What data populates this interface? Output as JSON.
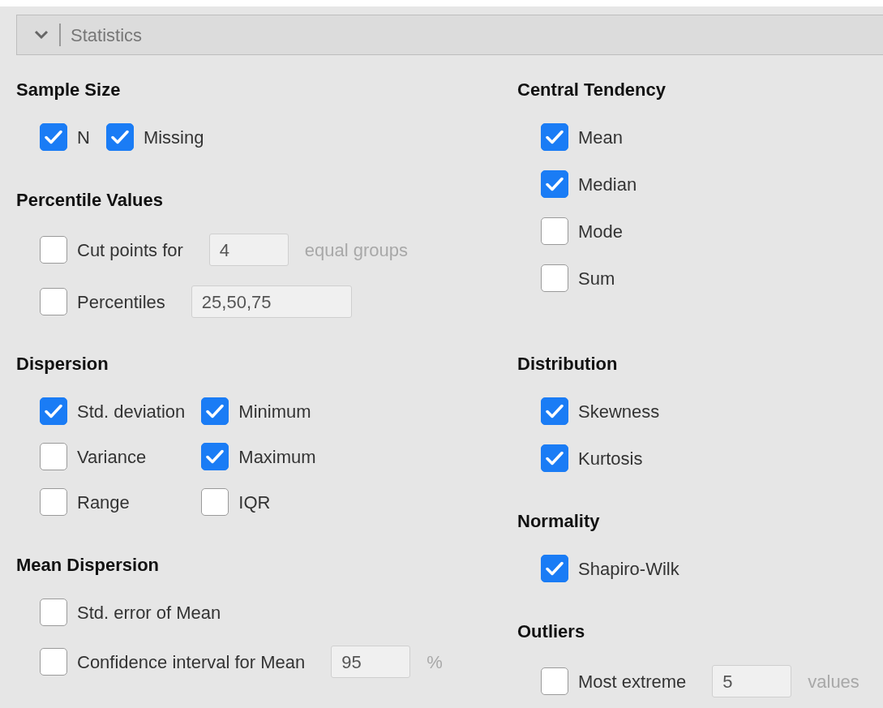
{
  "header": {
    "title": "Statistics",
    "expanded": true
  },
  "blocks": [
    {
      "left": [
        {
          "title": "Sample Size",
          "kind": "row",
          "items": [
            {
              "kind": "check",
              "label": "N",
              "checked": true
            },
            {
              "kind": "check",
              "label": "Missing",
              "checked": true
            }
          ]
        },
        {
          "title": "Percentile Values",
          "kind": "column",
          "items": [
            {
              "kind": "check-field",
              "label": "Cut points for",
              "checked": false,
              "value": "4",
              "suffix": "equal groups"
            },
            {
              "kind": "check-field",
              "label": "Percentiles",
              "checked": false,
              "value": "25,50,75"
            }
          ]
        }
      ],
      "right": [
        {
          "title": "Central Tendency",
          "kind": "column",
          "items": [
            {
              "kind": "check",
              "label": "Mean",
              "checked": true
            },
            {
              "kind": "check",
              "label": "Median",
              "checked": true
            },
            {
              "kind": "check",
              "label": "Mode",
              "checked": false
            },
            {
              "kind": "check",
              "label": "Sum",
              "checked": false
            }
          ]
        }
      ]
    },
    {
      "left": [
        {
          "title": "Dispersion",
          "kind": "grid",
          "items": [
            {
              "kind": "check",
              "label": "Std. deviation",
              "checked": true
            },
            {
              "kind": "check",
              "label": "Minimum",
              "checked": true
            },
            {
              "kind": "check",
              "label": "Variance",
              "checked": false
            },
            {
              "kind": "check",
              "label": "Maximum",
              "checked": true
            },
            {
              "kind": "check",
              "label": "Range",
              "checked": false
            },
            {
              "kind": "check",
              "label": "IQR",
              "checked": false
            }
          ]
        },
        {
          "title": "Mean Dispersion",
          "kind": "column",
          "items": [
            {
              "kind": "check",
              "label": "Std. error of Mean",
              "checked": false
            },
            {
              "kind": "check-field",
              "label": "Confidence interval for Mean",
              "checked": false,
              "value": "95",
              "suffix": "%"
            }
          ]
        }
      ],
      "right": [
        {
          "title": "Distribution",
          "kind": "column",
          "items": [
            {
              "kind": "check",
              "label": "Skewness",
              "checked": true
            },
            {
              "kind": "check",
              "label": "Kurtosis",
              "checked": true
            }
          ]
        },
        {
          "title": "Normality",
          "kind": "column",
          "items": [
            {
              "kind": "check",
              "label": "Shapiro-Wilk",
              "checked": true
            }
          ]
        },
        {
          "title": "Outliers",
          "kind": "column",
          "items": [
            {
              "kind": "check-field",
              "label": "Most extreme",
              "checked": false,
              "value": "5",
              "suffix": "values"
            }
          ]
        }
      ]
    }
  ]
}
